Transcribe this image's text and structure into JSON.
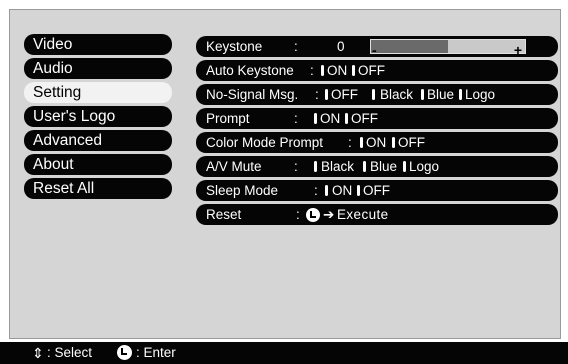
{
  "left_menu": {
    "items": [
      {
        "label": "Video"
      },
      {
        "label": "Audio"
      },
      {
        "label": "Setting"
      },
      {
        "label": "User's Logo"
      },
      {
        "label": "Advanced"
      },
      {
        "label": "About"
      },
      {
        "label": "Reset All"
      }
    ],
    "selected": "Setting"
  },
  "settings": {
    "keystone": {
      "label": "Keystone",
      "colon": ":",
      "value": "0",
      "minus": "-",
      "plus": "+",
      "level": 0.5
    },
    "auto_keystone": {
      "label": "Auto Keystone",
      "colon": ":",
      "opt1": "ON",
      "opt2": "OFF"
    },
    "no_signal": {
      "label": "No-Signal Msg.",
      "colon": ":",
      "opt1": "OFF",
      "opt2": "Black",
      "opt3": "Blue",
      "opt4": "Logo"
    },
    "prompt": {
      "label": "Prompt",
      "colon": ":",
      "opt1": "ON",
      "opt2": "OFF"
    },
    "color_mode_prompt": {
      "label": "Color Mode Prompt",
      "colon": ":",
      "opt1": "ON",
      "opt2": "OFF"
    },
    "av_mute": {
      "label": "A/V Mute",
      "colon": ":",
      "opt1": "Black",
      "opt2": "Blue",
      "opt3": "Logo"
    },
    "sleep_mode": {
      "label": "Sleep Mode",
      "colon": ":",
      "opt1": "ON",
      "opt2": "OFF"
    },
    "reset": {
      "label": "Reset",
      "colon": ":",
      "arrow": "➔",
      "action": "Execute"
    }
  },
  "footer": {
    "select_icon": "⇕",
    "select_label": ": Select",
    "enter_label": ": Enter"
  },
  "icons": {
    "select": "up-down-arrow-icon",
    "enter": "enter-icon"
  },
  "colors": {
    "menu_bg": "#050505",
    "selected_bg": "#f2f2f2",
    "screen_bg": "#d5d5d5"
  }
}
